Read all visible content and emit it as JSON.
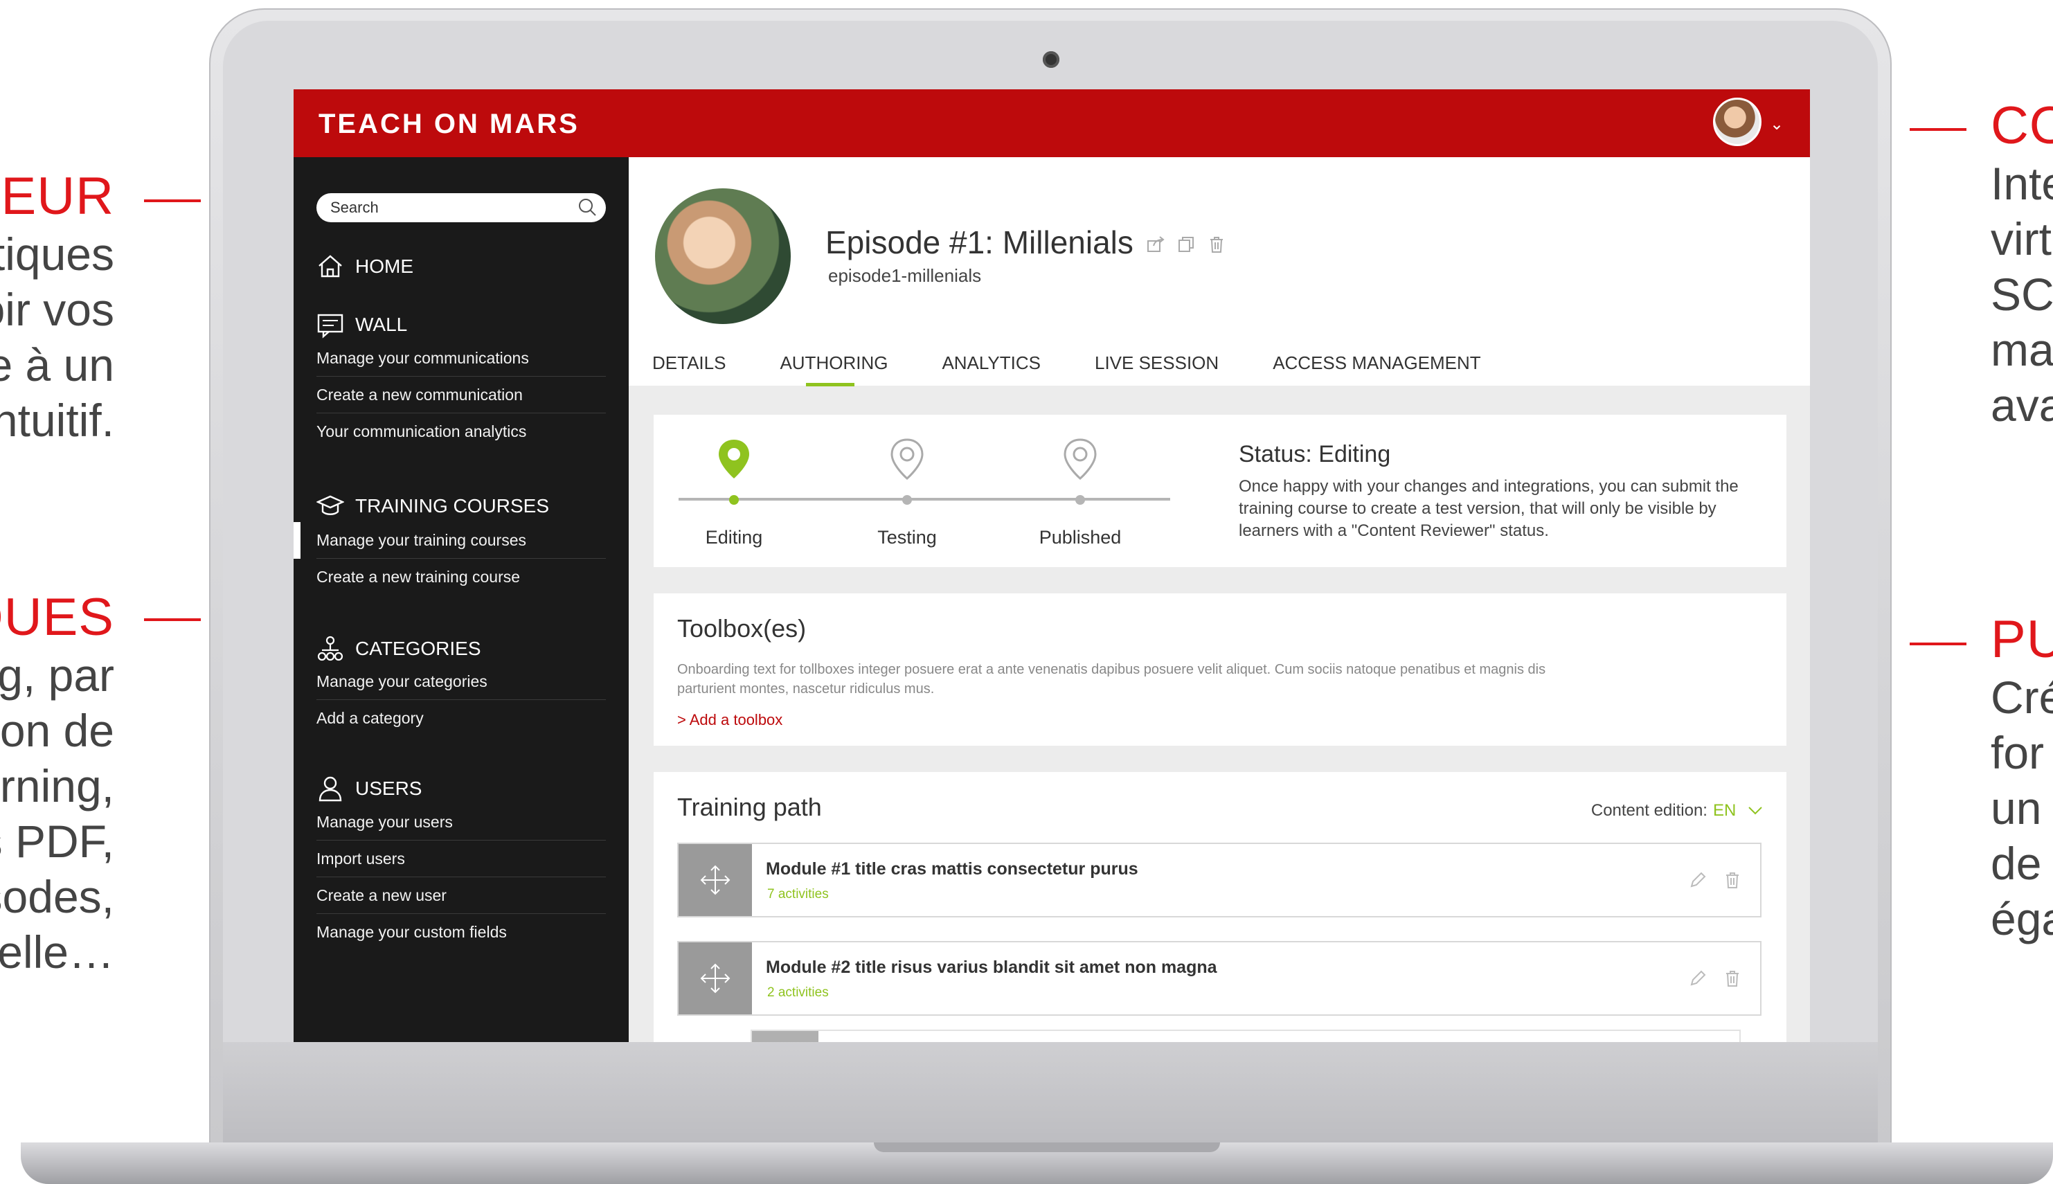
{
  "side": {
    "left1": {
      "heading": "AUTEUR",
      "lines": [
        "Des outils pratiques",
        "pour concevoir vos",
        "parcours grâce à un",
        "back-office intuitif."
      ]
    },
    "left2": {
      "heading": "FORMATS PÉDAGOGIQUES",
      "lines": [
        "Quiz, vidéo, e-learning, par",
        "exemple une collection de",
        "formats : micro-learning,",
        "documents PDF,",
        "épisodes,",
        "par l'échelle à l'échelle…"
      ]
    },
    "right1": {
      "heading": "CO",
      "lines": [
        "Inte",
        "virt",
        "SC",
        "ma",
        "ava"
      ]
    },
    "right2": {
      "heading": "PU",
      "lines": [
        "Cré",
        "for",
        "un",
        "de",
        "éga"
      ]
    }
  },
  "app": {
    "logo": "TEACH ON MARS",
    "accent": "#bd0a0c",
    "green": "#8fc31f"
  },
  "sidebar": {
    "search_placeholder": "Search",
    "sections": [
      {
        "label": "HOME",
        "icon": "home-icon"
      },
      {
        "label": "WALL",
        "icon": "wall-icon",
        "items": [
          "Manage your communications",
          "Create a new communication",
          "Your communication analytics"
        ]
      },
      {
        "label": "TRAINING COURSES",
        "icon": "graduation-cap-icon",
        "items": [
          "Manage your training courses",
          "Create a new training course"
        ]
      },
      {
        "label": "CATEGORIES",
        "icon": "hierarchy-icon",
        "items": [
          "Manage your categories",
          "Add a category"
        ]
      },
      {
        "label": "USERS",
        "icon": "user-icon",
        "items": [
          "Manage your users",
          "Import users",
          "Create a new user",
          "Manage your custom fields"
        ]
      }
    ]
  },
  "episode": {
    "title": "Episode #1: Millenials",
    "slug": "episode1-millenials"
  },
  "tabs": [
    "DETAILS",
    "AUTHORING",
    "ANALYTICS",
    "LIVE SESSION",
    "ACCESS MANAGEMENT"
  ],
  "status": {
    "steps": [
      "Editing",
      "Testing",
      "Published"
    ],
    "title": "Status: Editing",
    "text": "Once happy with your changes and integrations, you can submit the training course to create a test version, that will only be visible by learners with a \"Content Reviewer\" status."
  },
  "toolbox": {
    "title": "Toolbox(es)",
    "text": "Onboarding text for tollboxes integer posuere erat a ante venenatis dapibus posuere velit aliquet. Cum sociis natoque penatibus et magnis dis parturient montes, nascetur ridiculus mus.",
    "link": "> Add a toolbox"
  },
  "training_path": {
    "title": "Training path",
    "content_edition_label": "Content edition:",
    "language": "EN",
    "modules": [
      {
        "title": "Module #1 title cras mattis consectetur purus",
        "activities": "7 activities"
      },
      {
        "title": "Module #2 title risus varius blandit sit amet non magna",
        "activities": "2 activities"
      }
    ]
  }
}
